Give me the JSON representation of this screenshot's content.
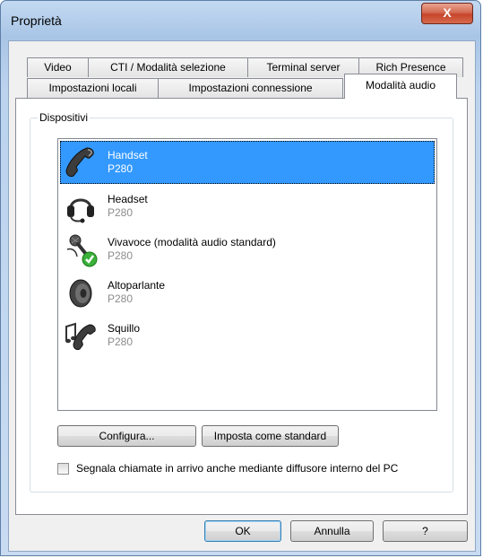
{
  "window": {
    "title": "Proprietà",
    "close_label": "X"
  },
  "tabs_row1": [
    {
      "label": "Video"
    },
    {
      "label": "CTI / Modalità selezione"
    },
    {
      "label": "Terminal server"
    },
    {
      "label": "Rich Presence"
    }
  ],
  "tabs_row2": [
    {
      "label": "Impostazioni locali"
    },
    {
      "label": "Impostazioni connessione"
    },
    {
      "label": "Modalità audio",
      "selected": true
    }
  ],
  "group": {
    "label": "Dispositivi",
    "devices": [
      {
        "name": "Handset",
        "model": "P280",
        "icon": "handset-icon",
        "selected": true
      },
      {
        "name": "Headset",
        "model": "P280",
        "icon": "headset-icon"
      },
      {
        "name": "Vivavoce (modalità audio standard)",
        "model": "P280",
        "icon": "speakerphone-microphone-icon",
        "default": true
      },
      {
        "name": "Altoparlante",
        "model": "P280",
        "icon": "loudspeaker-icon"
      },
      {
        "name": "Squillo",
        "model": "P280",
        "icon": "ringer-icon"
      }
    ],
    "configure_label": "Configura...",
    "set_default_label": "Imposta come standard",
    "checkbox_label": "Segnala chiamate in arrivo anche mediante diffusore interno del PC",
    "checkbox_checked": false
  },
  "footer": {
    "ok_label": "OK",
    "cancel_label": "Annulla",
    "help_label": "?"
  },
  "colors": {
    "selection": "#3399ff",
    "subtext": "#8c8c8c",
    "close_button": "#c7452b"
  }
}
